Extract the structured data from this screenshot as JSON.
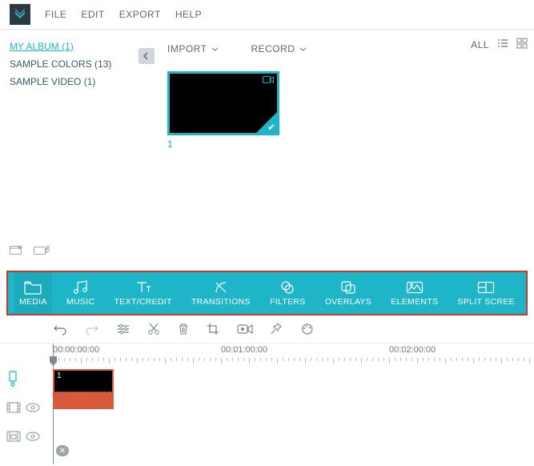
{
  "menu": {
    "file": "FILE",
    "edit": "EDIT",
    "export": "EXPORT",
    "help": "HELP"
  },
  "sidebar": {
    "items": [
      {
        "label": "MY ALBUM (1)",
        "active": true
      },
      {
        "label": "SAMPLE COLORS (13)",
        "active": false
      },
      {
        "label": "SAMPLE VIDEO (1)",
        "active": false
      }
    ]
  },
  "import": {
    "import_label": "IMPORT",
    "record_label": "RECORD",
    "all_label": "ALL"
  },
  "thumb": {
    "id": "1"
  },
  "tabs": [
    {
      "id": "media",
      "label": "MEDIA"
    },
    {
      "id": "music",
      "label": "MUSIC"
    },
    {
      "id": "text",
      "label": "TEXT/CREDIT"
    },
    {
      "id": "transitions",
      "label": "TRANSITIONS"
    },
    {
      "id": "filters",
      "label": "FILTERS"
    },
    {
      "id": "overlays",
      "label": "OVERLAYS"
    },
    {
      "id": "elements",
      "label": "ELEMENTS"
    },
    {
      "id": "split",
      "label": "SPLIT SCREE"
    }
  ],
  "timeline": {
    "labels": [
      "00:00:00:00",
      "00:01:00:00",
      "00:02:00:00"
    ],
    "clip_label": "1"
  }
}
